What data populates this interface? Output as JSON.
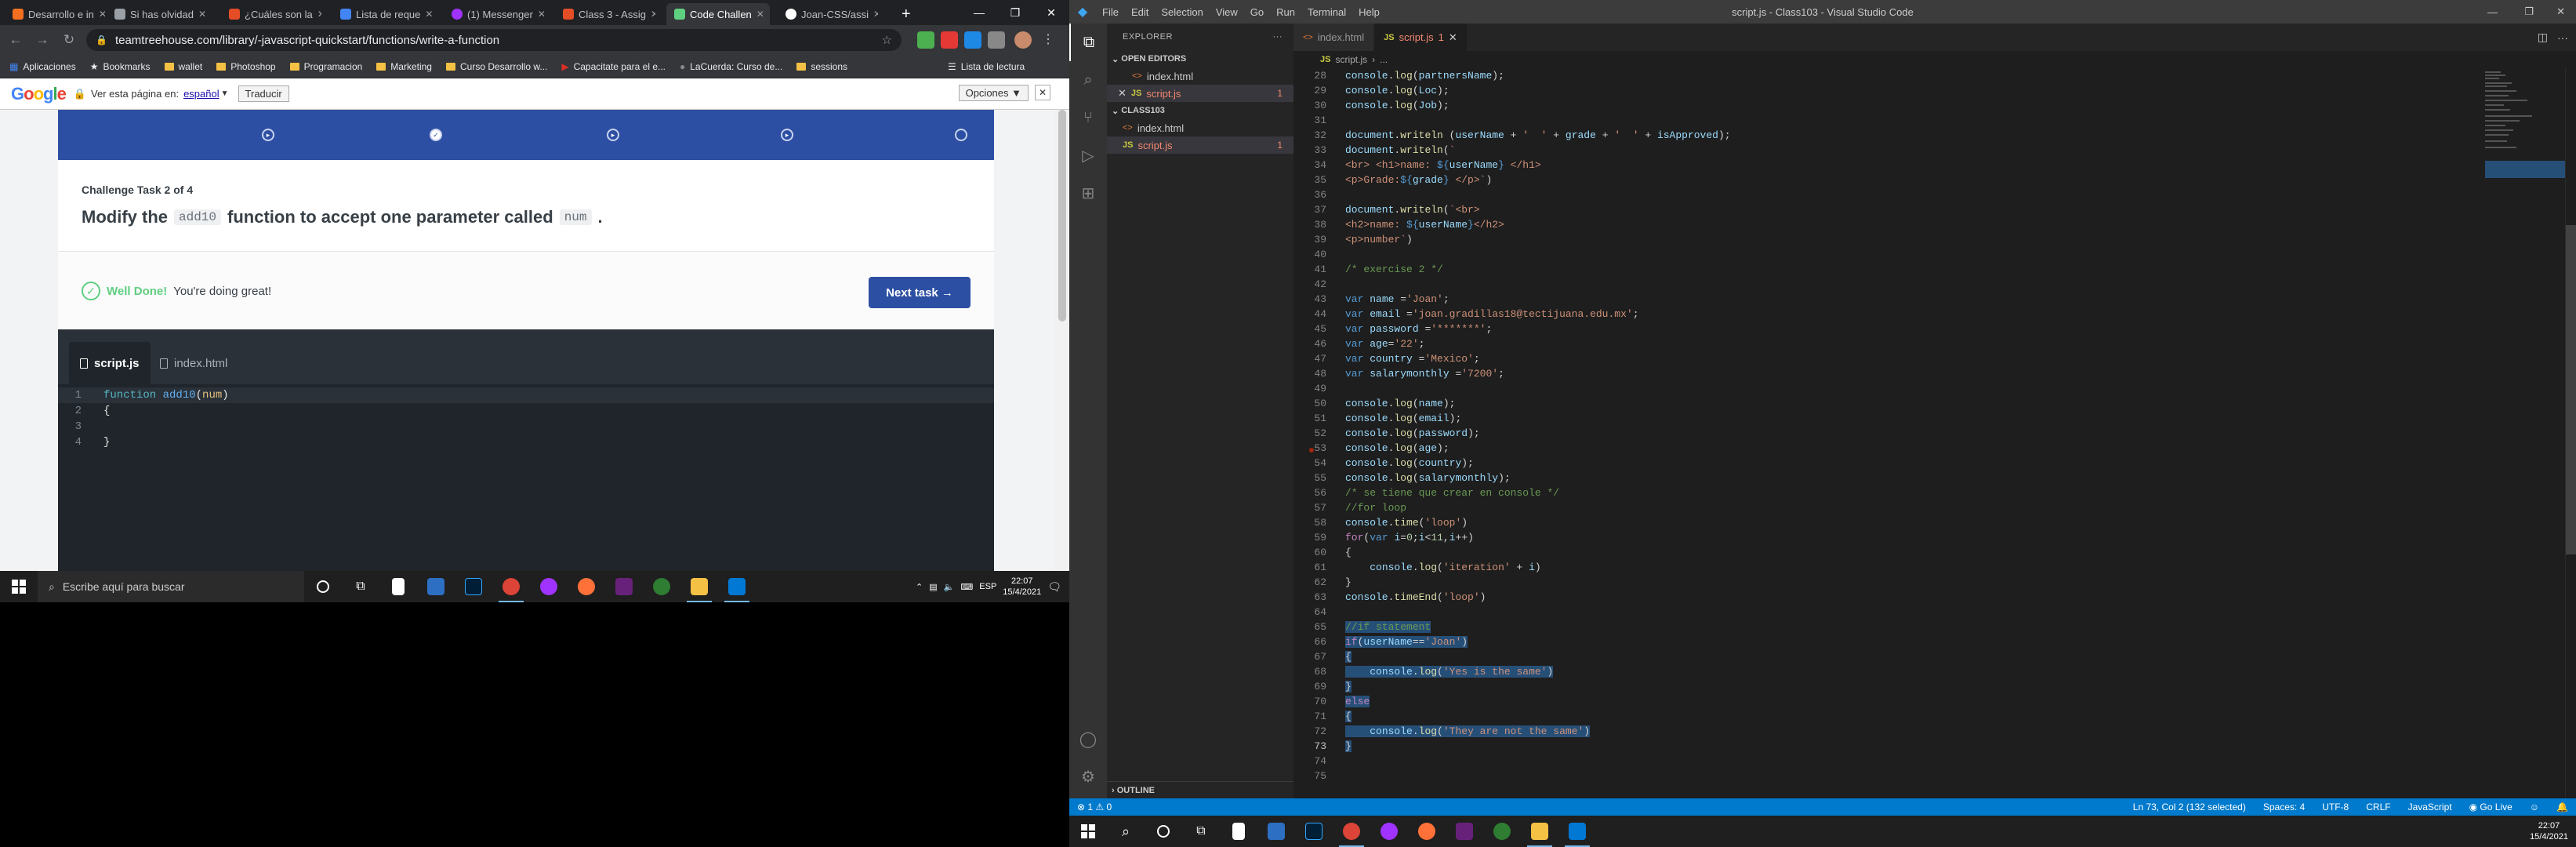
{
  "browser": {
    "tabs": [
      {
        "label": "Desarrollo e in",
        "color": "#f37021"
      },
      {
        "label": "Si has olvidad",
        "color": "#9aa0a6"
      },
      {
        "label": "¿Cuáles son la",
        "color": "#e44d26"
      },
      {
        "label": "Lista de reque",
        "color": "#4285f4"
      },
      {
        "label": "(1) Messenger",
        "color": "#a033ff"
      },
      {
        "label": "Class 3 - Assig",
        "color": "#e44d26"
      },
      {
        "label": "Code Challen",
        "color": "#5fcf80"
      },
      {
        "label": "Joan-CSS/assi",
        "color": "#ffffff"
      }
    ],
    "new_tab": "+",
    "url": "teamtreehouse.com/library/-javascript-quickstart/functions/write-a-function",
    "bookmarks": [
      "Aplicaciones",
      "Bookmarks",
      "wallet",
      "Photoshop",
      "Programacion",
      "Marketing",
      "Curso Desarrollo w...",
      "Capacitate para el e...",
      "LaCuerda: Curso de...",
      "sessions"
    ],
    "reading_list": "Lista de lectura",
    "translate": {
      "brand": "Google",
      "prompt": "Ver esta página en:",
      "language": "español",
      "translate_button": "Traducir",
      "options_button": "Opciones ▼",
      "close": "✕"
    }
  },
  "challenge": {
    "task_label": "Challenge Task 2 of 4",
    "desc_prefix": "Modify the",
    "desc_code1": "add10",
    "desc_middle": "function to accept one parameter called",
    "desc_code2": "num",
    "desc_suffix": ".",
    "success_strong": "Well Done!",
    "success_text": "You're doing great!",
    "next_button": "Next task →",
    "editor_tabs": [
      "script.js",
      "index.html"
    ]
  },
  "left_taskbar": {
    "search_placeholder": "Escribe aquí para buscar",
    "lang": "ESP",
    "time": "22:07",
    "date": "15/4/2021"
  },
  "vscode": {
    "menu": [
      "File",
      "Edit",
      "Selection",
      "View",
      "Go",
      "Run",
      "Terminal",
      "Help"
    ],
    "window_title": "script.js - Class103 - Visual Studio Code",
    "explorer_title": "EXPLORER",
    "open_editors_section": "OPEN EDITORS",
    "project_section": "CLASS103",
    "outline_section": "OUTLINE",
    "files": [
      "index.html",
      "script.js"
    ],
    "error_count": "1",
    "tab_modified_marker": "1",
    "breadcrumb": [
      "script.js",
      "..."
    ],
    "status": {
      "problems": "⊗ 1 ⚠ 0",
      "position": "Ln 73, Col 2 (132 selected)",
      "spaces": "Spaces: 4",
      "encoding": "UTF-8",
      "eol": "CRLF",
      "language": "JavaScript",
      "live": "Go Live"
    },
    "taskbar_time": "22:07",
    "taskbar_date": "15/4/2021"
  }
}
